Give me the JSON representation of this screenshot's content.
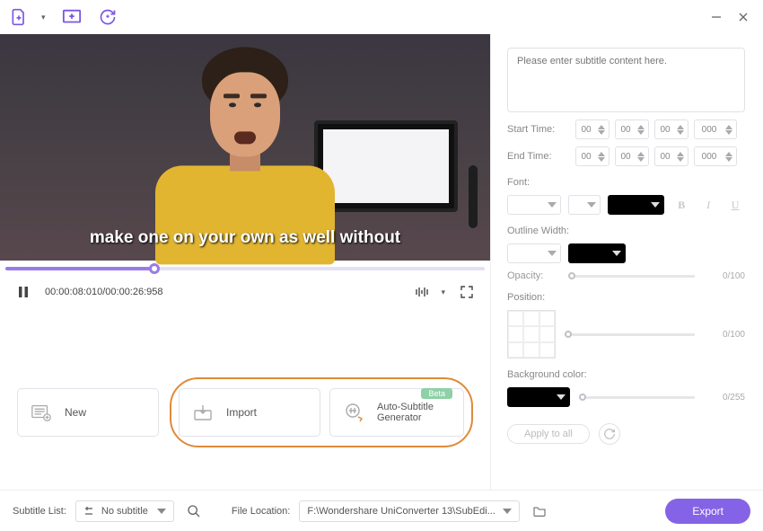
{
  "caption_text": "make one on your own as well without",
  "timecode": "00:00:08:010/00:00:26:958",
  "cards": {
    "new": "New",
    "import": "Import",
    "auto": "Auto-Subtitle Generator",
    "badge": "Beta"
  },
  "subtitle_placeholder": "Please enter subtitle content here.",
  "labels": {
    "start_time": "Start Time:",
    "end_time": "End Time:",
    "font": "Font:",
    "outline": "Outline Width:",
    "opacity": "Opacity:",
    "position": "Position:",
    "bgcolor": "Background color:",
    "apply": "Apply to all",
    "subtitle_list": "Subtitle List:",
    "file_location": "File Location:",
    "export": "Export"
  },
  "time": {
    "start": {
      "h": "00",
      "m": "00",
      "s": "00",
      "ms": "000"
    },
    "end": {
      "h": "00",
      "m": "00",
      "s": "00",
      "ms": "000"
    }
  },
  "opacity_value": "0/100",
  "position_value": "0/100",
  "bgcolor_value": "0/255",
  "subtitle_list_value": "No subtitle",
  "file_location_value": "F:\\Wondershare UniConverter 13\\SubEdi..."
}
